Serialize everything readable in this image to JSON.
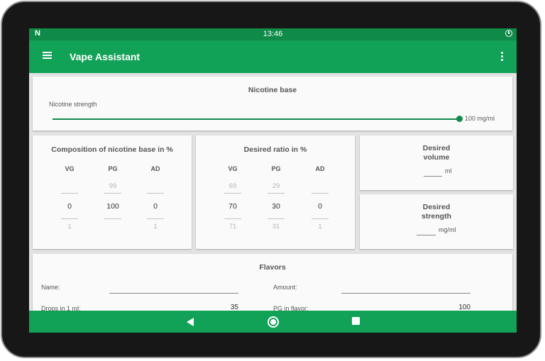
{
  "status_bar": {
    "time": "13:46",
    "left_icon": "N"
  },
  "app_bar": {
    "title": "Vape Assistant"
  },
  "nicotine_base": {
    "title": "Nicotine base",
    "strength_label": "Nicotine strength",
    "strength_value": "100 mg/ml",
    "slider_level": 1.0
  },
  "composition": {
    "title": "Composition of nicotine base in %",
    "columns": [
      {
        "header": "VG",
        "above": "",
        "current": "0",
        "below": "1"
      },
      {
        "header": "PG",
        "above": "99",
        "current": "100",
        "below": ""
      },
      {
        "header": "AD",
        "above": "",
        "current": "0",
        "below": "1"
      }
    ]
  },
  "desired_ratio": {
    "title": "Desired ratio in %",
    "columns": [
      {
        "header": "VG",
        "above": "69",
        "current": "70",
        "below": "71"
      },
      {
        "header": "PG",
        "above": "29",
        "current": "30",
        "below": "31"
      },
      {
        "header": "AD",
        "above": "",
        "current": "0",
        "below": "1"
      }
    ]
  },
  "desired_volume": {
    "title_line1": "Desired",
    "title_line2": "volume",
    "unit": "ml",
    "value": ""
  },
  "desired_strength": {
    "title_line1": "Desired",
    "title_line2": "strength",
    "unit": "mg/ml",
    "value": ""
  },
  "flavors": {
    "title": "Flavors",
    "name_label": "Name:",
    "name_value": "",
    "amount_label": "Amount:",
    "amount_value": "",
    "drops_label": "Drops in 1 ml:",
    "drops_value": "35",
    "pg_label": "PG in flavor:",
    "pg_value": "100"
  }
}
